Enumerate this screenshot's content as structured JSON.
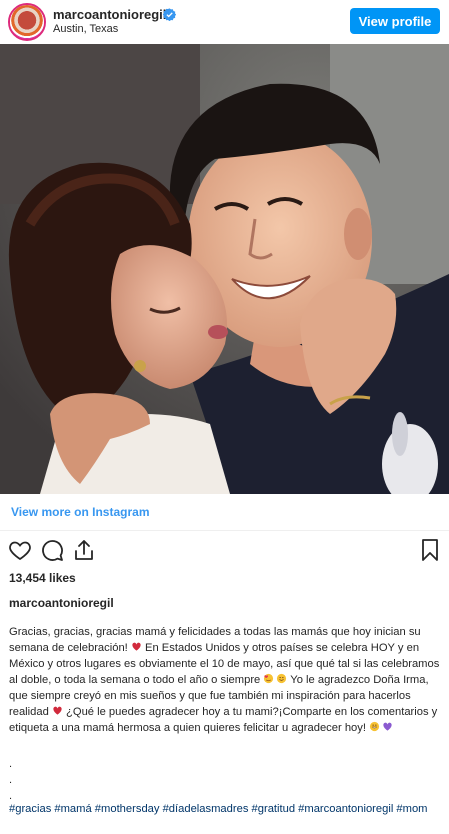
{
  "header": {
    "username": "marcoantonioregil",
    "location": "Austin, Texas",
    "view_profile_label": "View profile"
  },
  "post": {
    "photo_alt": "",
    "view_more_label": "View more on Instagram",
    "likes": "13,454 likes",
    "caption_username": "marcoantonioregil",
    "caption_parts": [
      "Gracias, gracias, gracias mamá y felicidades a todas las mamás que hoy inician su semana de celebración! ",
      " En Estados Unidos y otros países se celebra HOY y en México y otros lugares es obviamente el 10 de mayo, así que qué tal si las celebramos al doble, o toda la semana o todo el año o siempre ",
      " Yo le agradezco Doña Irma, que siempre creyó en mis sueños y que fue también mi inspiración para hacerlos realidad ",
      " ¿Qué le puedes agradecer hoy a tu mami?¡Comparte en los comentarios y etiqueta a una mamá hermosa a quien quieres felicitar u agradecer hoy! "
    ],
    "dots": [
      ".",
      ".",
      "."
    ],
    "hashtags": "#gracias #mamá #mothersday #díadelasmadres #gratitud #marcoantonioregil #mom"
  },
  "icons": {
    "verified": "verified-badge-icon",
    "like": "heart-icon",
    "comment": "comment-icon",
    "share": "share-icon",
    "save": "bookmark-icon"
  },
  "colors": {
    "accent": "#0095f6",
    "link": "#3897f0",
    "hashtag": "#003569"
  }
}
